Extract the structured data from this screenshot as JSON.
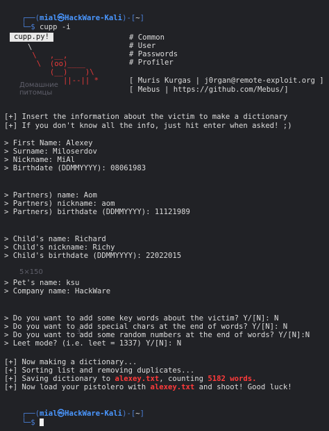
{
  "prompt": {
    "top_left": "┌──(",
    "user_host": "mial㉿HackWare-Kali",
    "middle": ")-[",
    "dir": "~",
    "end": "]",
    "bottom_left": "└─$ ",
    "command": "cupp -i"
  },
  "banner": {
    "label": "cupp.py!",
    "right_lines": [
      "# Common",
      "# User",
      "# Passwords",
      "# Profiler"
    ],
    "ascii_lines": [
      "\\",
      " \\   ,__,",
      "  \\  (oo)____",
      "     (__)    )\\",
      "        ||--|| *"
    ],
    "credit_1": "[ Muris Kurgas | j0rgan@remote-exploit.org ]",
    "credit_2": "[ Mebus | https://github.com/Mebus/]"
  },
  "intro": [
    "[+] Insert the information about the victim to make a dictionary",
    "[+] If you don't know all the info, just hit enter when asked! ;)"
  ],
  "victim": [
    "> First Name: Alexey",
    "> Surname: Miloserdov",
    "> Nickname: MiAl",
    "> Birthdate (DDMMYYYY): 08061983"
  ],
  "partner": [
    "> Partners) name: Aom",
    "> Partners) nickname: aom",
    "> Partners) birthdate (DDMMYYYY): 11121989"
  ],
  "child": [
    "> Child's name: Richard",
    "> Child's nickname: Richy",
    "> Child's birthdate (DDMMYYYY): 22022015"
  ],
  "other": [
    "> Pet's name: ksu",
    "> Company name: HackWare"
  ],
  "questions": [
    "> Do you want to add some key words about the victim? Y/[N]: N",
    "> Do you want to add special chars at the end of words? Y/[N]: N",
    "> Do you want to add some random numbers at the end of words? Y/[N]:N",
    "> Leet mode? (i.e. leet = 1337) Y/[N]: N"
  ],
  "result": {
    "making": "[+] Now making a dictionary...",
    "sorting": "[+] Sorting list and removing duplicates...",
    "saving_prefix": "[+] Saving dictionary to ",
    "filename": "alexey.txt",
    "saving_middle": ", counting ",
    "count": "5182 words.",
    "load_prefix": "[+] Now load your pistolero with ",
    "load_suffix": " and shoot! Good luck!"
  },
  "watermark": {
    "top": "Домашние\nпитомцы",
    "middle": "5×150",
    "lower": "3..."
  },
  "colors": {
    "background": "#212226",
    "prompt_blue": "#3c8df0",
    "highlight_red": "#ff3b3b"
  }
}
